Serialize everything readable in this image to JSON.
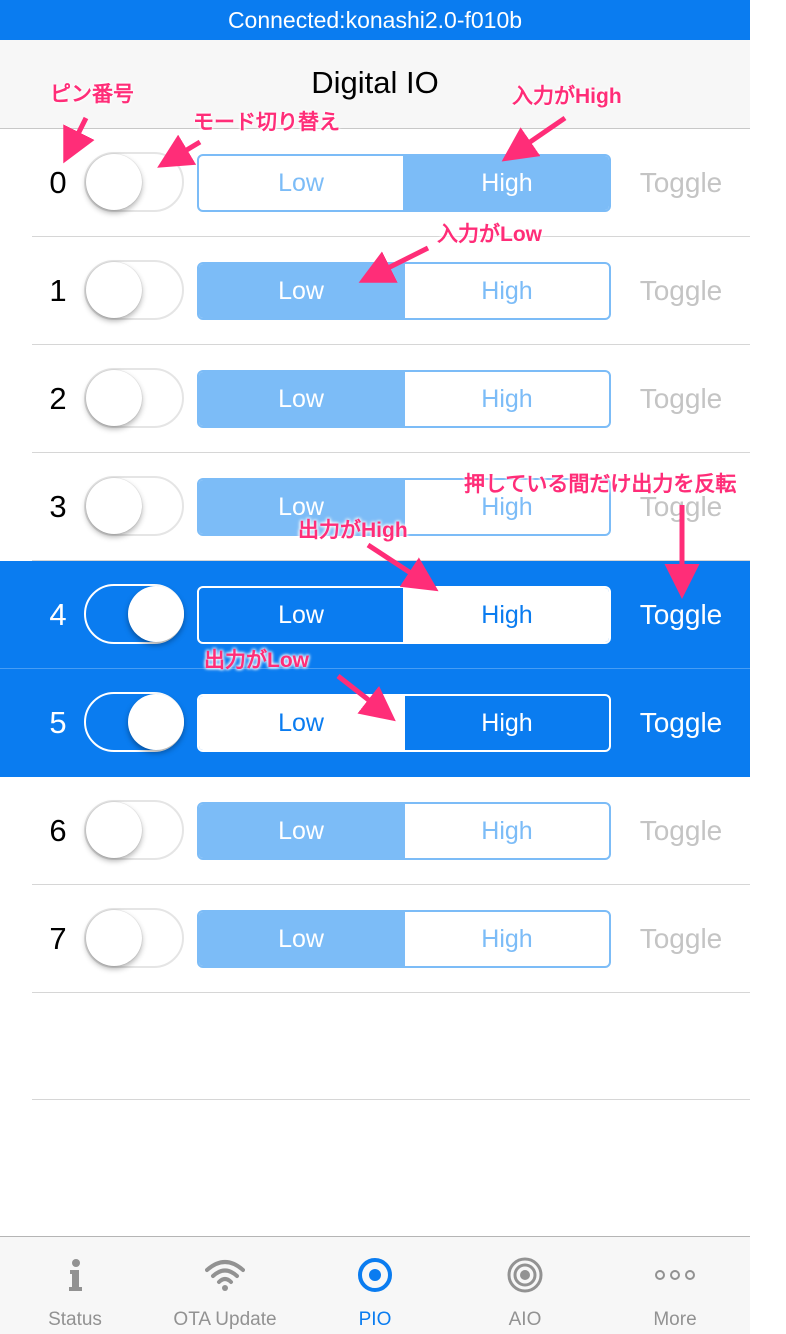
{
  "status_bar": {
    "text": "Connected:konashi2.0-f010b"
  },
  "nav": {
    "title": "Digital IO"
  },
  "pins": [
    {
      "pin": "0",
      "output_mode": false,
      "level": "High",
      "low_label": "Low",
      "high_label": "High",
      "toggle_label": "Toggle"
    },
    {
      "pin": "1",
      "output_mode": false,
      "level": "Low",
      "low_label": "Low",
      "high_label": "High",
      "toggle_label": "Toggle"
    },
    {
      "pin": "2",
      "output_mode": false,
      "level": "Low",
      "low_label": "Low",
      "high_label": "High",
      "toggle_label": "Toggle"
    },
    {
      "pin": "3",
      "output_mode": false,
      "level": "Low",
      "low_label": "Low",
      "high_label": "High",
      "toggle_label": "Toggle"
    },
    {
      "pin": "4",
      "output_mode": true,
      "level": "High",
      "low_label": "Low",
      "high_label": "High",
      "toggle_label": "Toggle"
    },
    {
      "pin": "5",
      "output_mode": true,
      "level": "Low",
      "low_label": "Low",
      "high_label": "High",
      "toggle_label": "Toggle"
    },
    {
      "pin": "6",
      "output_mode": false,
      "level": "Low",
      "low_label": "Low",
      "high_label": "High",
      "toggle_label": "Toggle"
    },
    {
      "pin": "7",
      "output_mode": false,
      "level": "Low",
      "low_label": "Low",
      "high_label": "High",
      "toggle_label": "Toggle"
    }
  ],
  "annotations": {
    "pin_number": "ピン番号",
    "mode_switch": "モード切り替え",
    "input_high": "入力がHigh",
    "input_low": "入力がLow",
    "toggle_press": "押している間だけ出力を反転",
    "output_high": "出力がHigh",
    "output_low": "出力がLow"
  },
  "tabs": [
    {
      "label": "Status",
      "icon": "info-icon",
      "active": false
    },
    {
      "label": "OTA Update",
      "icon": "wifi-icon",
      "active": false
    },
    {
      "label": "PIO",
      "icon": "pio-icon",
      "active": true
    },
    {
      "label": "AIO",
      "icon": "aio-icon",
      "active": false
    },
    {
      "label": "More",
      "icon": "more-icon",
      "active": false
    }
  ],
  "colors": {
    "accent": "#0a7cf0",
    "segment_light": "#7cbcf7",
    "annotation": "#ff2d78",
    "inactive_text": "#c4c4c4"
  }
}
